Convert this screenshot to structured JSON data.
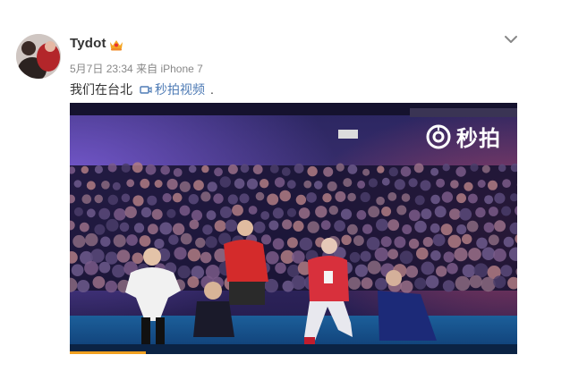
{
  "post": {
    "user": {
      "name": "Tydot"
    },
    "meta": {
      "date": "5月7日",
      "time": "23:34",
      "source_prefix": "来自",
      "device": "iPhone 7"
    },
    "text": "我们在台北",
    "video_link_label": "秒拍视频",
    "trailing": ".",
    "media": {
      "watermark": "秒拍"
    }
  },
  "icons": {
    "badge": "vip-crown-icon",
    "dropdown": "chevron-down-icon",
    "video_link": "video-camera-icon",
    "watermark": "miaopai-logo-icon"
  },
  "colors": {
    "link": "#4e7bb5",
    "name": "#333333",
    "meta": "#888888",
    "badge": "#f5a623"
  }
}
